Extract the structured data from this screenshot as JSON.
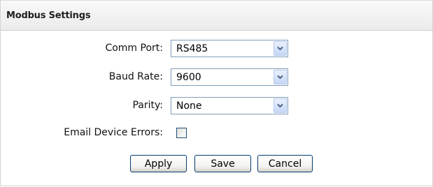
{
  "panel": {
    "title": "Modbus Settings"
  },
  "form": {
    "comm_port": {
      "label": "Comm Port:",
      "value": "RS485",
      "icon": "chevron-down-icon"
    },
    "baud_rate": {
      "label": "Baud Rate:",
      "value": "9600",
      "icon": "chevron-down-icon"
    },
    "parity": {
      "label": "Parity:",
      "value": "None",
      "icon": "chevron-down-icon"
    },
    "email_device_errors": {
      "label": "Email Device Errors:",
      "checked": false
    }
  },
  "buttons": {
    "apply": "Apply",
    "save": "Save",
    "cancel": "Cancel"
  },
  "colors": {
    "select_border": "#7f9db9",
    "arrow_glyph": "#4d6185",
    "button_border": "#003c74"
  }
}
